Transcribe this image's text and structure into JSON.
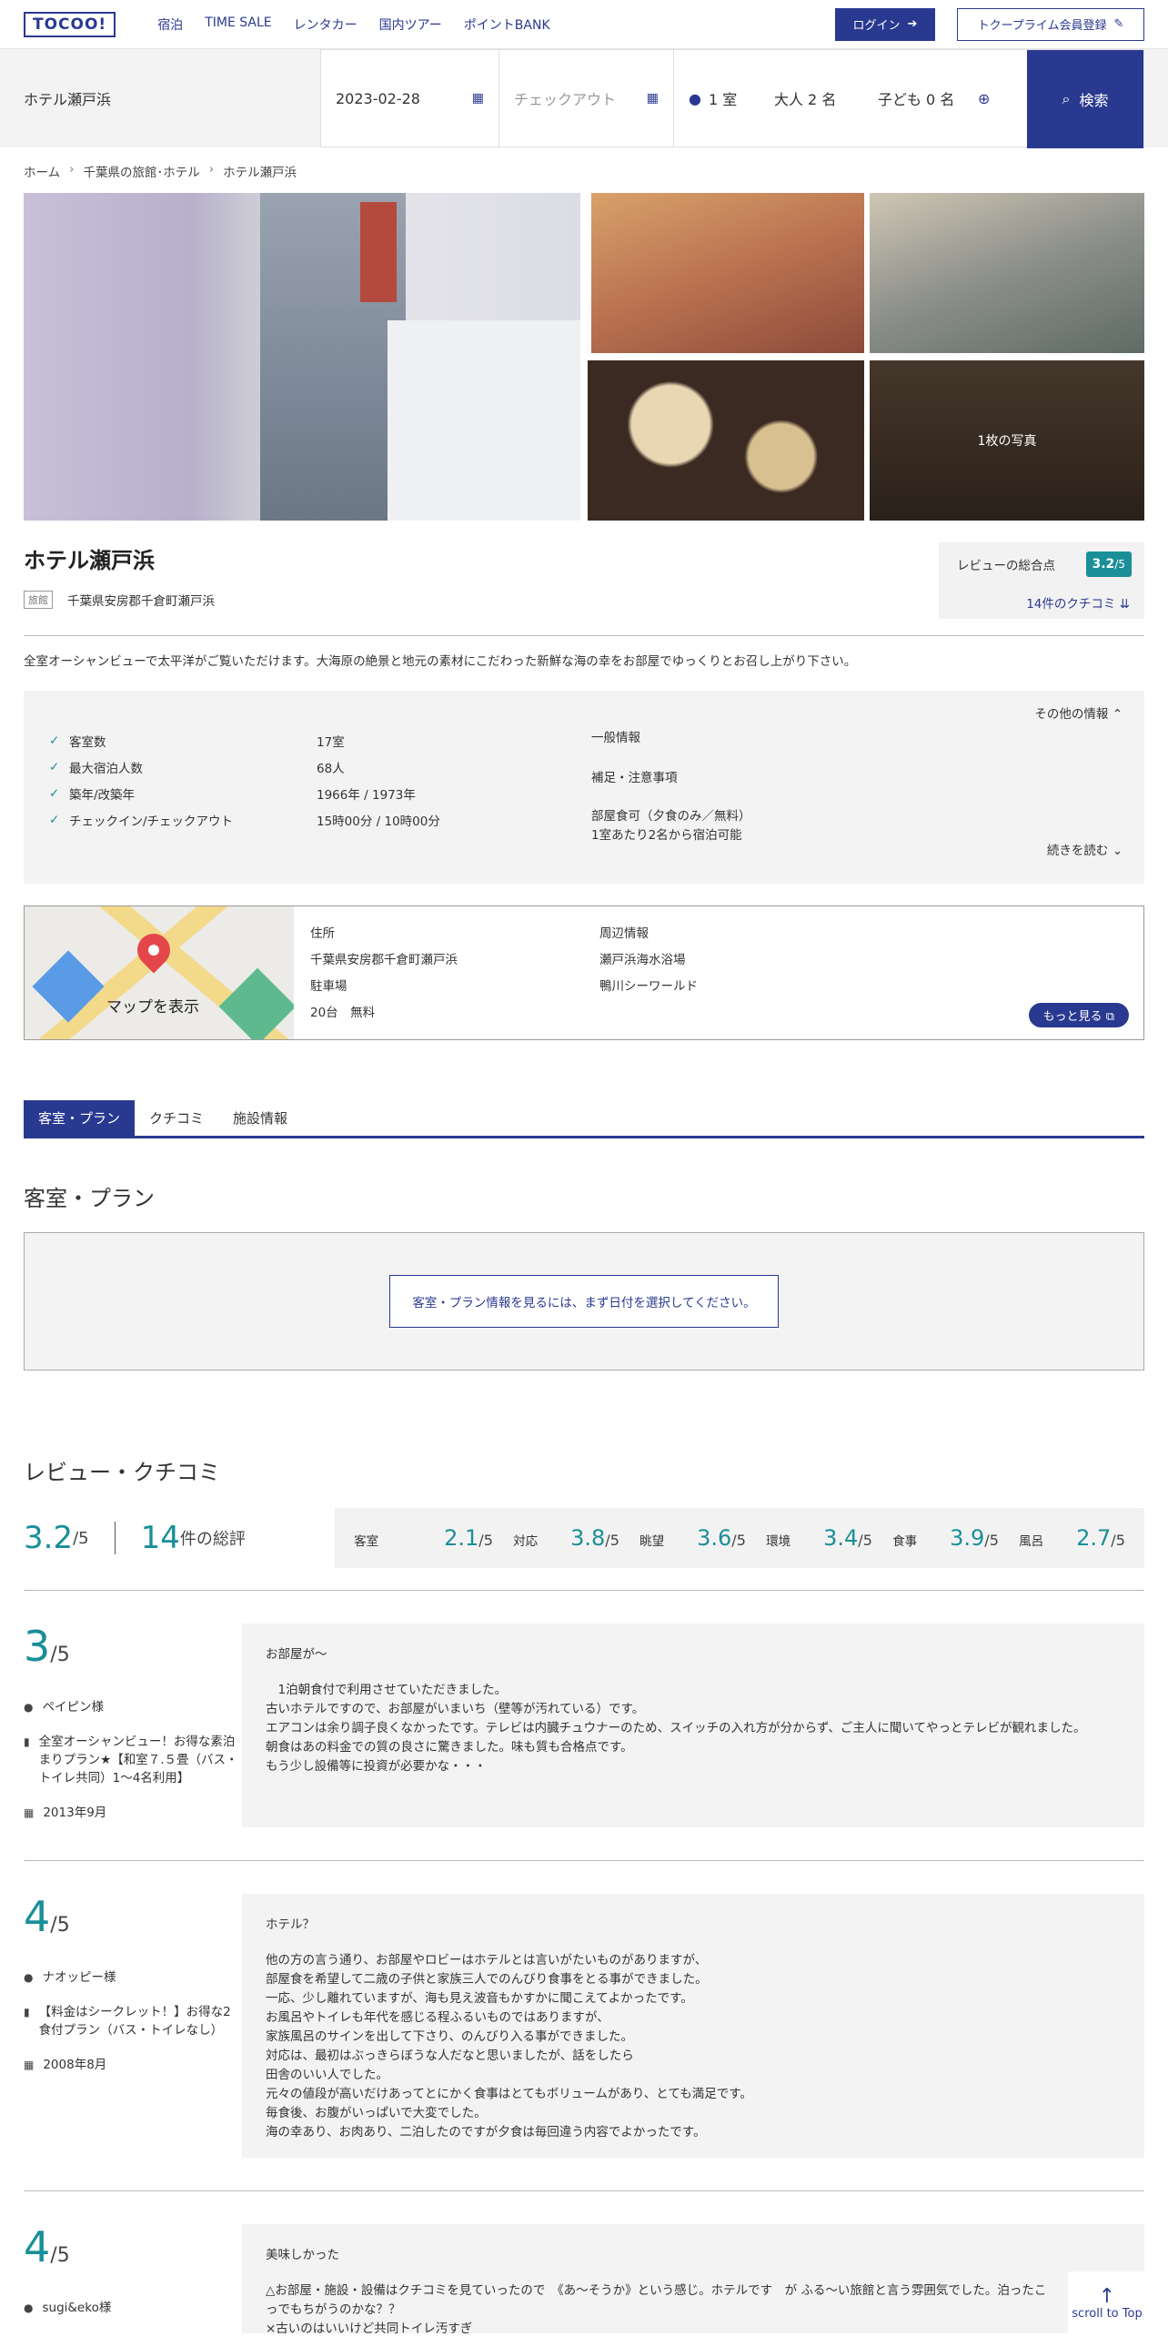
{
  "header": {
    "logo": "TOCOO!",
    "nav": [
      "宿泊",
      "TIME SALE",
      "レンタカー",
      "国内ツアー",
      "ポイントBANK"
    ],
    "login": "ログイン",
    "register": "トクープライム会員登録"
  },
  "search": {
    "title": "ホテル瀬戸浜",
    "checkin": "2023-02-28",
    "checkout_placeholder": "チェックアウト",
    "rooms": "1 室",
    "adults": "大人  2 名",
    "children": "子ども  0 名",
    "button": "検索"
  },
  "breadcrumb": [
    "ホーム",
    "千葉県の旅館･ホテル",
    "ホテル瀬戸浜"
  ],
  "gallery": {
    "more_photos": "1枚の写真"
  },
  "hotel": {
    "name": "ホテル瀬戸浜",
    "type_tag": "旅館",
    "address": "千葉県安房郡千倉町瀬戸浜",
    "review_label": "レビューの総合点",
    "score": "3.2",
    "score_max": "/5",
    "review_count": "14件のクチコミ",
    "description": "全室オーシャンビューで太平洋がご覧いただけます。大海原の絶景と地元の素材にこだわった新鮮な海の幸をお部屋でゆっくりとお召し上がり下さい。"
  },
  "info": {
    "toggle_top": "その他の情報",
    "facts": [
      {
        "k": "客室数",
        "v": "17室"
      },
      {
        "k": "最大宿泊人数",
        "v": "68人"
      },
      {
        "k": "築年/改築年",
        "v": "1966年 / 1973年"
      },
      {
        "k": "チェックイン/チェックアウト",
        "v": "15時00分 / 10時00分"
      }
    ],
    "general_title": "一般情報",
    "notes_title": "補足・注意事項",
    "notes": [
      "部屋食可（夕食のみ／無料）",
      "1室あたり2名から宿泊可能"
    ],
    "toggle_bottom": "続きを読む"
  },
  "map": {
    "label": "マップを表示",
    "address_title": "住所",
    "address": "千葉県安房郡千倉町瀬戸浜",
    "parking_title": "駐車場",
    "parking": "20台　無料",
    "nearby_title": "周辺情報",
    "nearby": [
      "瀬戸浜海水浴場",
      "鴨川シーワールド"
    ],
    "more": "もっと見る"
  },
  "tabs": [
    "客室・プラン",
    "クチコミ",
    "施設情報"
  ],
  "plans": {
    "title": "客室・プラン",
    "message": "客室・プラン情報を見るには、まず日付を選択してください。"
  },
  "reviews": {
    "title": "レビュー・クチコミ",
    "total": "3.2",
    "max": "/5",
    "count": "14",
    "count_label": "件の総評",
    "categories": [
      {
        "name": "客室",
        "value": "2.1"
      },
      {
        "name": "対応",
        "value": "3.8"
      },
      {
        "name": "眺望",
        "value": "3.6"
      },
      {
        "name": "環境",
        "value": "3.4"
      },
      {
        "name": "食事",
        "value": "3.9"
      },
      {
        "name": "風呂",
        "value": "2.7"
      }
    ],
    "items": [
      {
        "score": "3",
        "user": "ペイピン様",
        "plan": "全室オーシャンビュー！お得な素泊まりプラン★【和室７.５畳（バス・トイレ共同）1〜4名利用】",
        "date": "2013年9月",
        "title": "お部屋が〜",
        "lines": [
          "　1泊朝食付で利用させていただきました。",
          "古いホテルですので、お部屋がいまいち（壁等が汚れている）です。",
          "エアコンは余り調子良くなかったです。テレビは内臓チュウナーのため、スイッチの入れ方が分からず、ご主人に聞いてやっとテレビが観れました。",
          "朝食はあの料金での質の良さに驚きました。味も質も合格点です。",
          "もう少し設備等に投資が必要かな・・・"
        ]
      },
      {
        "score": "4",
        "user": "ナオッピー様",
        "plan": "【料金はシークレット！】お得な2食付プラン（バス・トイレなし）",
        "date": "2008年8月",
        "title": "ホテル？",
        "lines": [
          "他の方の言う通り、お部屋やロビーはホテルとは言いがたいものがありますが、",
          "部屋食を希望して二歳の子供と家族三人でのんびり食事をとる事ができました。",
          "一応、少し離れていますが、海も見え波音もかすかに聞こえてよかったです。",
          "お風呂やトイレも年代を感じる程ふるいものではありますが、",
          "家族風呂のサインを出して下さり、のんびり入る事ができました。",
          "対応は、最初はぶっきらぼうな人だなと思いましたが、話をしたら",
          "田舎のいい人でした。",
          "元々の値段が高いだけあってとにかく食事はとてもボリュームがあり、とても満足です。",
          "毎食後、お腹がいっぱいで大変でした。",
          "海の幸あり、お肉あり、二泊したのですが夕食は毎回違う内容でよかったです。"
        ]
      },
      {
        "score": "4",
        "user": "sugi&eko様",
        "plan": "",
        "date": "",
        "title": "美味しかった",
        "lines": [
          "△お部屋・施設・設備はクチコミを見ていったので　《あ〜そうか》という感じ。ホテルです　が ふる〜い旅館と言う雰囲気でした。泊ったこ",
          "っでもちがうのかな？？",
          "×古いのはいいけど共同トイレ汚すぎ"
        ]
      }
    ]
  },
  "scroll_top": "scroll to Top",
  "colors": {
    "navy": "#2a3990",
    "teal": "#1a8f98"
  }
}
